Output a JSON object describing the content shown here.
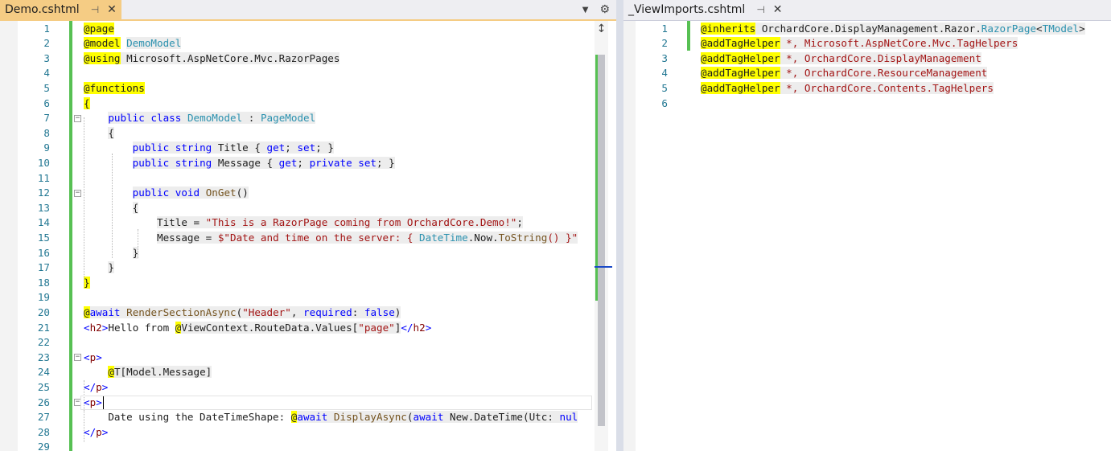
{
  "left_tab": {
    "title": "Demo.cshtml",
    "pin_icon": "pin-icon",
    "close_icon": "close-icon"
  },
  "right_tab": {
    "title": "_ViewImports.cshtml",
    "pin_icon": "pin-icon",
    "close_icon": "close-icon"
  },
  "tab_tools": {
    "dropdown_icon": "chevron-down-icon",
    "settings_icon": "gear-icon"
  },
  "left_editor": {
    "line_numbers": [
      "1",
      "2",
      "3",
      "4",
      "5",
      "6",
      "7",
      "8",
      "9",
      "10",
      "11",
      "12",
      "13",
      "14",
      "15",
      "16",
      "17",
      "18",
      "19",
      "20",
      "21",
      "22",
      "23",
      "24",
      "25",
      "26",
      "27",
      "28",
      "29"
    ],
    "lines": [
      [
        {
          "t": "@page",
          "c": "rz"
        }
      ],
      [
        {
          "t": "@model",
          "c": "rz"
        },
        {
          "t": " "
        },
        {
          "t": "DemoModel",
          "c": "cls gray"
        }
      ],
      [
        {
          "t": "@using",
          "c": "rz"
        },
        {
          "t": " Microsoft.AspNetCore.Mvc.RazorPages",
          "c": "gray"
        }
      ],
      [],
      [
        {
          "t": "@functions",
          "c": "rz"
        }
      ],
      [
        {
          "t": "{",
          "c": "rz"
        }
      ],
      [
        {
          "t": "    "
        },
        {
          "t": "public",
          "c": "kw gray"
        },
        {
          "t": " ",
          "c": "gray"
        },
        {
          "t": "class",
          "c": "kw gray"
        },
        {
          "t": " ",
          "c": "gray"
        },
        {
          "t": "DemoModel",
          "c": "cls gray"
        },
        {
          "t": " : ",
          "c": "gray"
        },
        {
          "t": "PageModel",
          "c": "cls gray"
        }
      ],
      [
        {
          "t": "    "
        },
        {
          "t": "{",
          "c": "gray"
        }
      ],
      [
        {
          "t": "        "
        },
        {
          "t": "public",
          "c": "kw gray"
        },
        {
          "t": " ",
          "c": "gray"
        },
        {
          "t": "string",
          "c": "kw gray"
        },
        {
          "t": " Title { ",
          "c": "gray"
        },
        {
          "t": "get",
          "c": "kw gray"
        },
        {
          "t": "; ",
          "c": "gray"
        },
        {
          "t": "set",
          "c": "kw gray"
        },
        {
          "t": "; }",
          "c": "gray"
        }
      ],
      [
        {
          "t": "        "
        },
        {
          "t": "public",
          "c": "kw gray"
        },
        {
          "t": " ",
          "c": "gray"
        },
        {
          "t": "string",
          "c": "kw gray"
        },
        {
          "t": " Message { ",
          "c": "gray"
        },
        {
          "t": "get",
          "c": "kw gray"
        },
        {
          "t": "; ",
          "c": "gray"
        },
        {
          "t": "private",
          "c": "kw gray"
        },
        {
          "t": " ",
          "c": "gray"
        },
        {
          "t": "set",
          "c": "kw gray"
        },
        {
          "t": "; }",
          "c": "gray"
        }
      ],
      [],
      [
        {
          "t": "        "
        },
        {
          "t": "public",
          "c": "kw gray"
        },
        {
          "t": " ",
          "c": "gray"
        },
        {
          "t": "void",
          "c": "kw gray"
        },
        {
          "t": " ",
          "c": "gray"
        },
        {
          "t": "OnGet",
          "c": "method gray"
        },
        {
          "t": "()",
          "c": "gray"
        }
      ],
      [
        {
          "t": "        "
        },
        {
          "t": "{",
          "c": "gray"
        }
      ],
      [
        {
          "t": "            "
        },
        {
          "t": "Title = ",
          "c": "gray"
        },
        {
          "t": "\"This is a RazorPage coming from OrchardCore.Demo!\"",
          "c": "str gray"
        },
        {
          "t": ";",
          "c": "gray"
        }
      ],
      [
        {
          "t": "            "
        },
        {
          "t": "Message = ",
          "c": "gray"
        },
        {
          "t": "$\"Date and time on the server: { ",
          "c": "str gray"
        },
        {
          "t": "DateTime",
          "c": "cls gray"
        },
        {
          "t": ".Now.",
          "c": "gray"
        },
        {
          "t": "ToString",
          "c": "method gray"
        },
        {
          "t": "() }\"",
          "c": "str gray"
        }
      ],
      [
        {
          "t": "        "
        },
        {
          "t": "}",
          "c": "gray"
        }
      ],
      [
        {
          "t": "    "
        },
        {
          "t": "}",
          "c": "gray"
        }
      ],
      [
        {
          "t": "}",
          "c": "rz"
        }
      ],
      [],
      [
        {
          "t": "@",
          "c": "rz"
        },
        {
          "t": "await",
          "c": "kw gray"
        },
        {
          "t": " ",
          "c": "gray"
        },
        {
          "t": "RenderSectionAsync",
          "c": "method gray"
        },
        {
          "t": "(",
          "c": "gray"
        },
        {
          "t": "\"Header\"",
          "c": "str gray"
        },
        {
          "t": ", ",
          "c": "gray"
        },
        {
          "t": "required",
          "c": "kw gray"
        },
        {
          "t": ": ",
          "c": "gray"
        },
        {
          "t": "false",
          "c": "kw gray"
        },
        {
          "t": ")",
          "c": "gray"
        }
      ],
      [
        {
          "t": "<",
          "c": "kw"
        },
        {
          "t": "h2",
          "c": "tagc"
        },
        {
          "t": ">",
          "c": "kw"
        },
        {
          "t": "Hello from "
        },
        {
          "t": "@",
          "c": "rz"
        },
        {
          "t": "ViewContext.RouteData.Values[",
          "c": "gray"
        },
        {
          "t": "\"page\"",
          "c": "str gray"
        },
        {
          "t": "]",
          "c": "gray"
        },
        {
          "t": "</",
          "c": "kw"
        },
        {
          "t": "h2",
          "c": "tagc"
        },
        {
          "t": ">",
          "c": "kw"
        }
      ],
      [],
      [
        {
          "t": "<",
          "c": "kw"
        },
        {
          "t": "p",
          "c": "tagc"
        },
        {
          "t": ">",
          "c": "kw"
        }
      ],
      [
        {
          "t": "    "
        },
        {
          "t": "@",
          "c": "rz"
        },
        {
          "t": "T[Model.Message]",
          "c": "gray"
        }
      ],
      [
        {
          "t": "</",
          "c": "kw"
        },
        {
          "t": "p",
          "c": "tagc"
        },
        {
          "t": ">",
          "c": "kw"
        }
      ],
      [
        {
          "t": "<",
          "c": "kw"
        },
        {
          "t": "p",
          "c": "tagc"
        },
        {
          "t": ">",
          "c": "kw"
        }
      ],
      [
        {
          "t": "    Date using the DateTimeShape: "
        },
        {
          "t": "@",
          "c": "rz"
        },
        {
          "t": "await",
          "c": "kw gray"
        },
        {
          "t": " ",
          "c": "gray"
        },
        {
          "t": "DisplayAsync",
          "c": "method gray"
        },
        {
          "t": "(",
          "c": "gray"
        },
        {
          "t": "await",
          "c": "kw gray"
        },
        {
          "t": " New.DateTime(Utc: ",
          "c": "gray"
        },
        {
          "t": "nul",
          "c": "kw gray"
        }
      ],
      [
        {
          "t": "</",
          "c": "kw"
        },
        {
          "t": "p",
          "c": "tagc"
        },
        {
          "t": ">",
          "c": "kw"
        }
      ],
      []
    ]
  },
  "right_editor": {
    "line_numbers": [
      "1",
      "2",
      "3",
      "4",
      "5",
      "6"
    ],
    "lines": [
      [
        {
          "t": "@inherits",
          "c": "rz"
        },
        {
          "t": " OrchardCore.DisplayManagement.Razor.",
          "c": "gray"
        },
        {
          "t": "RazorPage",
          "c": "cls gray"
        },
        {
          "t": "<",
          "c": "gray"
        },
        {
          "t": "TModel",
          "c": "cls gray"
        },
        {
          "t": ">",
          "c": "gray"
        }
      ],
      [
        {
          "t": "@addTagHelper",
          "c": "rz"
        },
        {
          "t": " ",
          "c": "gray"
        },
        {
          "t": "*, Microsoft.AspNetCore.Mvc.TagHelpers",
          "c": "str gray"
        }
      ],
      [
        {
          "t": "@addTagHelper",
          "c": "rz"
        },
        {
          "t": " ",
          "c": "gray"
        },
        {
          "t": "*, OrchardCore.DisplayManagement",
          "c": "str gray"
        }
      ],
      [
        {
          "t": "@addTagHelper",
          "c": "rz"
        },
        {
          "t": " ",
          "c": "gray"
        },
        {
          "t": "*, OrchardCore.ResourceManagement",
          "c": "str gray"
        }
      ],
      [
        {
          "t": "@addTagHelper",
          "c": "rz"
        },
        {
          "t": " ",
          "c": "gray"
        },
        {
          "t": "*, OrchardCore.Contents.TagHelpers",
          "c": "str gray"
        }
      ],
      []
    ]
  },
  "colors": {
    "active_tab": "#F5CC84",
    "change_bar": "#57C053",
    "razor_highlight": "#FFFF00",
    "keyword": "#0000FF",
    "type": "#2B91AF",
    "string": "#A31515",
    "line_number": "#237893"
  }
}
